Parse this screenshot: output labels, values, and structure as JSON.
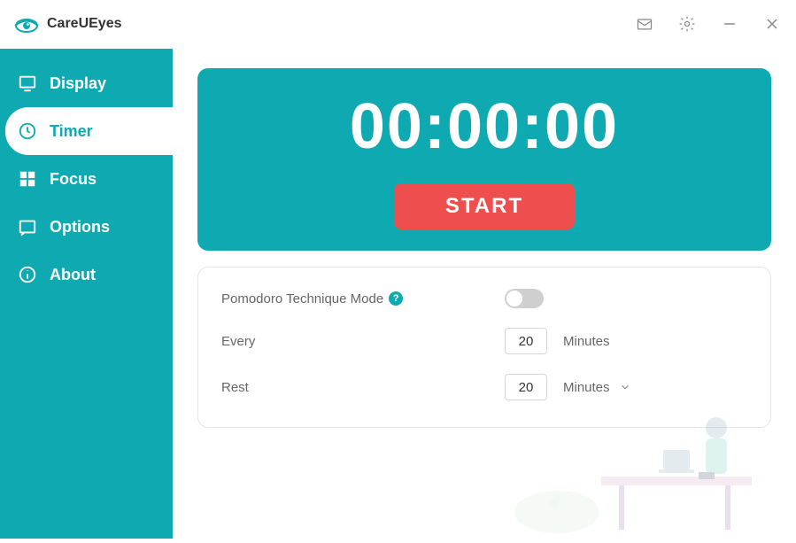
{
  "header": {
    "app_title": "CareUEyes"
  },
  "sidebar": {
    "items": [
      {
        "label": "Display",
        "key": "display"
      },
      {
        "label": "Timer",
        "key": "timer"
      },
      {
        "label": "Focus",
        "key": "focus"
      },
      {
        "label": "Options",
        "key": "options"
      },
      {
        "label": "About",
        "key": "about"
      }
    ],
    "active": "timer"
  },
  "timer": {
    "display": "00:00:00",
    "start_label": "START"
  },
  "settings": {
    "pomodoro_label": "Pomodoro Technique Mode",
    "pomodoro_help": "?",
    "pomodoro_enabled": false,
    "every_label": "Every",
    "every_value": "20",
    "every_unit": "Minutes",
    "rest_label": "Rest",
    "rest_value": "20",
    "rest_unit": "Minutes"
  },
  "colors": {
    "accent": "#0fa9b1",
    "danger": "#ef4e4e"
  }
}
